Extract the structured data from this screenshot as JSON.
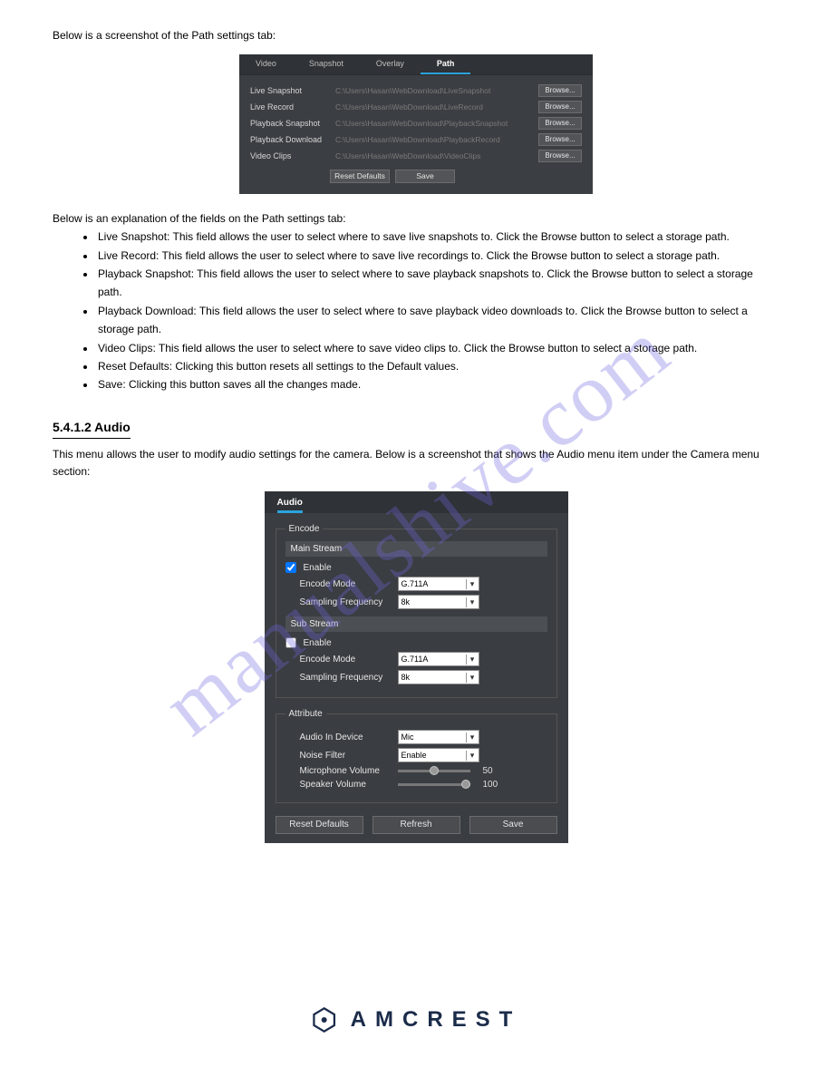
{
  "intro_above": "Below is a screenshot of the Path settings tab:",
  "path_panel": {
    "tabs": [
      "Video",
      "Snapshot",
      "Overlay",
      "Path"
    ],
    "active_tab_index": 3,
    "rows": [
      {
        "label": "Live Snapshot",
        "value": "C:\\Users\\Hasan\\WebDownload\\LiveSnapshot",
        "browse": "Browse..."
      },
      {
        "label": "Live Record",
        "value": "C:\\Users\\Hasan\\WebDownload\\LiveRecord",
        "browse": "Browse..."
      },
      {
        "label": "Playback Snapshot",
        "value": "C:\\Users\\Hasan\\WebDownload\\PlaybackSnapshot",
        "browse": "Browse..."
      },
      {
        "label": "Playback Download",
        "value": "C:\\Users\\Hasan\\WebDownload\\PlaybackRecord",
        "browse": "Browse..."
      },
      {
        "label": "Video Clips",
        "value": "C:\\Users\\Hasan\\WebDownload\\VideoClips",
        "browse": "Browse..."
      }
    ],
    "buttons": {
      "reset": "Reset Defaults",
      "save": "Save"
    }
  },
  "path_desc": "Below is an explanation of the fields on the Path settings tab:",
  "path_bullets": [
    "Live Snapshot: This field allows the user to select where to save live snapshots to. Click the Browse button to select a storage path.",
    "Live Record: This field allows the user to select where to save live recordings to. Click the Browse button to select a storage path.",
    "Playback Snapshot: This field allows the user to select where to save playback snapshots to. Click the Browse button to select a storage path.",
    "Playback Download: This field allows the user to select where to save playback video downloads to. Click the Browse button to select a storage path.",
    "Video Clips: This field allows the user to select where to save video clips to. Click the Browse button to select a storage path.",
    "Reset Defaults: Clicking this button resets all settings to the Default values.",
    "Save: Clicking this button saves all the changes made."
  ],
  "audio_heading": "5.4.1.2 Audio",
  "audio_desc": "This menu allows the user to modify audio settings for the camera. Below is a screenshot that shows the Audio menu item under the Camera menu section:",
  "audio_panel": {
    "tab": "Audio",
    "encode_legend": "Encode",
    "main_stream_header": "Main Stream",
    "sub_stream_header": "Sub Stream",
    "enable_label": "Enable",
    "encode_mode_label": "Encode Mode",
    "sampling_label": "Sampling Frequency",
    "main": {
      "enabled": true,
      "encode_mode": "G.711A",
      "sampling": "8k"
    },
    "sub": {
      "enabled": false,
      "encode_mode": "G.711A",
      "sampling": "8k"
    },
    "attribute_legend": "Attribute",
    "audio_in_label": "Audio In Device",
    "audio_in_value": "Mic",
    "noise_filter_label": "Noise Filter",
    "noise_filter_value": "Enable",
    "mic_vol_label": "Microphone Volume",
    "mic_vol_value": "50",
    "spk_vol_label": "Speaker Volume",
    "spk_vol_value": "100",
    "buttons": {
      "reset": "Reset Defaults",
      "refresh": "Refresh",
      "save": "Save"
    }
  },
  "watermark": "manualshive.com",
  "footer_brand": "AMCREST"
}
